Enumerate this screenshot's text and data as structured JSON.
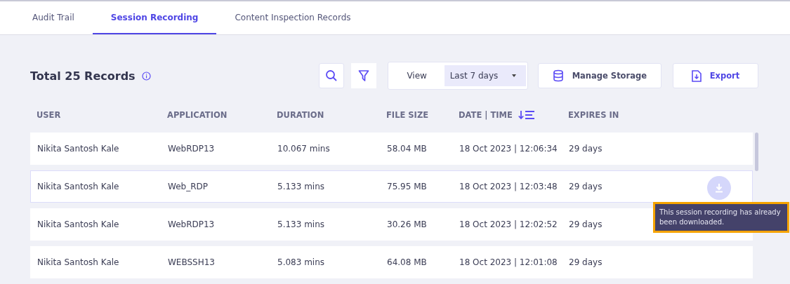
{
  "tabs": [
    {
      "label": "Audit Trail",
      "selected": false
    },
    {
      "label": "Session Recording",
      "selected": true
    },
    {
      "label": "Content Inspection Records",
      "selected": false
    }
  ],
  "title": "Total 25 Records",
  "toolbar": {
    "view_label": "View",
    "view_value": "Last 7 days",
    "manage_storage": "Manage Storage",
    "export": "Export"
  },
  "table": {
    "columns": [
      "USER",
      "APPLICATION",
      "DURATION",
      "FILE SIZE",
      "DATE | TIME",
      "EXPIRES IN"
    ],
    "rows": [
      {
        "cells": [
          "Nikita Santosh Kale",
          "WebRDP13",
          "10.067 mins",
          "58.04 MB",
          "18 Oct 2023 | 12:06:34",
          "29 days"
        ],
        "hovered": false
      },
      {
        "cells": [
          "Nikita Santosh Kale",
          "Web_RDP",
          "5.133 mins",
          "75.95 MB",
          "18 Oct 2023 | 12:03:48",
          "29 days"
        ],
        "hovered": true
      },
      {
        "cells": [
          "Nikita Santosh Kale",
          "WebRDP13",
          "5.133 mins",
          "30.26 MB",
          "18 Oct 2023 | 12:02:52",
          "29 days"
        ],
        "hovered": false
      },
      {
        "cells": [
          "Nikita Santosh Kale",
          "WEBSSH13",
          "5.083 mins",
          "64.08 MB",
          "18 Oct 2023 | 12:01:08",
          "29 days"
        ],
        "hovered": false
      }
    ]
  },
  "tooltip": "This session recording has already been downloaded."
}
